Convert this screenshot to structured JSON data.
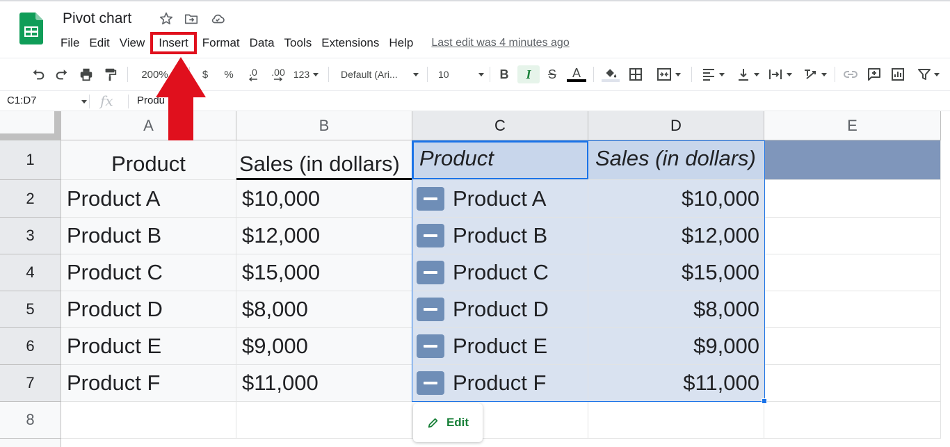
{
  "app": {
    "title": "Pivot chart",
    "brand_color": "#0f9d58"
  },
  "menu": {
    "items": [
      {
        "label": "File"
      },
      {
        "label": "Edit"
      },
      {
        "label": "View"
      },
      {
        "label": "Insert",
        "highlighted": true
      },
      {
        "label": "Format"
      },
      {
        "label": "Data"
      },
      {
        "label": "Tools"
      },
      {
        "label": "Extensions"
      },
      {
        "label": "Help"
      }
    ],
    "last_edit": "Last edit was 4 minutes ago"
  },
  "toolbar": {
    "zoom": "200%",
    "currency": "$",
    "percent": "%",
    "decrease_decimal": ".0",
    "increase_decimal": ".00",
    "more_formats": "123",
    "font": "Default (Ari...",
    "font_size": "10",
    "italic_active": true
  },
  "formula_bar": {
    "name_box": "C1:D7",
    "fx": "fx",
    "content": "Produ"
  },
  "sheet": {
    "columns": [
      "A",
      "B",
      "C",
      "D",
      "E"
    ],
    "rows": [
      "1",
      "2",
      "3",
      "4",
      "5",
      "6",
      "7",
      "8"
    ],
    "source_header": [
      "Product",
      "Sales (in dollars)"
    ],
    "source_rows": [
      [
        "Product A",
        "$10,000"
      ],
      [
        "Product B",
        "$12,000"
      ],
      [
        "Product C",
        "$15,000"
      ],
      [
        "Product D",
        "$8,000"
      ],
      [
        "Product E",
        "$9,000"
      ],
      [
        "Product F",
        "$11,000"
      ]
    ],
    "pivot_header": [
      "Product",
      "Sales (in dollars)"
    ],
    "pivot_rows": [
      [
        "Product A",
        "$10,000"
      ],
      [
        "Product B",
        "$12,000"
      ],
      [
        "Product C",
        "$15,000"
      ],
      [
        "Product D",
        "$8,000"
      ],
      [
        "Product E",
        "$9,000"
      ],
      [
        "Product F",
        "$11,000"
      ]
    ],
    "selection": "C1:D7",
    "selection_color": "#1a73e8",
    "pivot_fill": "#d9e2f0",
    "pivot_header_fill": "#7f96bb"
  },
  "pivot_edit": {
    "label": "Edit",
    "color": "#188038"
  },
  "annotation": {
    "arrow_color": "#e0101d"
  }
}
